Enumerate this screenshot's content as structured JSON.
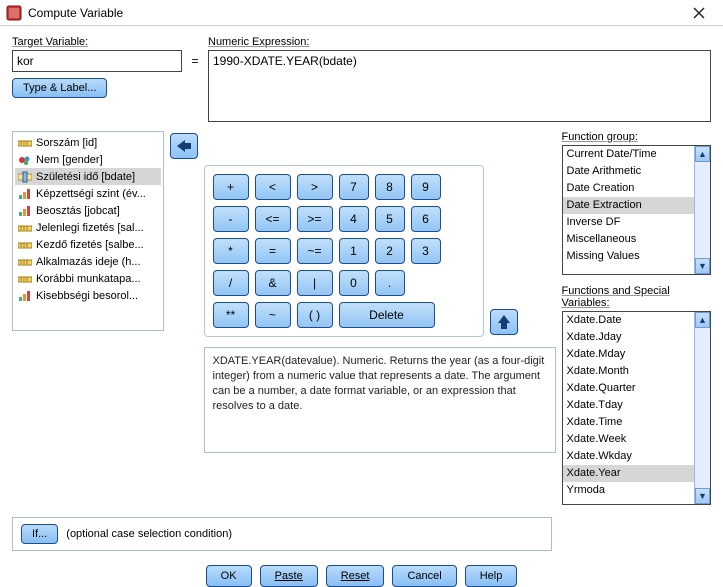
{
  "window": {
    "title": "Compute Variable"
  },
  "target": {
    "label": "Target Variable:",
    "value": "kor",
    "type_label_btn": "Type & Label..."
  },
  "equals": "=",
  "expression": {
    "label": "Numeric Expression:",
    "value": "1990-XDATE.YEAR(bdate)"
  },
  "variables": [
    {
      "label": "Sorszám [id]",
      "icon": "ruler",
      "selected": false
    },
    {
      "label": "Nem [gender]",
      "icon": "nominal",
      "selected": false
    },
    {
      "label": "Születési idő [bdate]",
      "icon": "scale",
      "selected": true
    },
    {
      "label": "Képzettségi szint (év...",
      "icon": "ordinal",
      "selected": false
    },
    {
      "label": "Beosztás [jobcat]",
      "icon": "ordinal",
      "selected": false
    },
    {
      "label": "Jelenlegi fizetés [sal...",
      "icon": "ruler",
      "selected": false
    },
    {
      "label": "Kezdő fizetés [salbe...",
      "icon": "ruler",
      "selected": false
    },
    {
      "label": "Alkalmazás ideje (h...",
      "icon": "ruler",
      "selected": false
    },
    {
      "label": "Korábbi munkatapa...",
      "icon": "ruler",
      "selected": false
    },
    {
      "label": "Kisebbségi besorol...",
      "icon": "ordinal",
      "selected": false
    }
  ],
  "keypad": {
    "rows": [
      [
        "+",
        "<",
        ">",
        "7",
        "8",
        "9"
      ],
      [
        "-",
        "<=",
        ">=",
        "4",
        "5",
        "6"
      ],
      [
        "*",
        "=",
        "~=",
        "1",
        "2",
        "3"
      ],
      [
        "/",
        "&",
        "|",
        "0",
        "."
      ],
      [
        "**",
        "~",
        "( )",
        "Delete"
      ]
    ]
  },
  "function_group": {
    "label": "Function group:",
    "items": [
      {
        "label": "Current Date/Time",
        "selected": false
      },
      {
        "label": "Date Arithmetic",
        "selected": false
      },
      {
        "label": "Date Creation",
        "selected": false
      },
      {
        "label": "Date Extraction",
        "selected": true
      },
      {
        "label": "Inverse DF",
        "selected": false
      },
      {
        "label": "Miscellaneous",
        "selected": false
      },
      {
        "label": "Missing Values",
        "selected": false
      }
    ]
  },
  "functions": {
    "label": "Functions and Special Variables:",
    "items": [
      {
        "label": "Xdate.Date",
        "selected": false
      },
      {
        "label": "Xdate.Jday",
        "selected": false
      },
      {
        "label": "Xdate.Mday",
        "selected": false
      },
      {
        "label": "Xdate.Month",
        "selected": false
      },
      {
        "label": "Xdate.Quarter",
        "selected": false
      },
      {
        "label": "Xdate.Tday",
        "selected": false
      },
      {
        "label": "Xdate.Time",
        "selected": false
      },
      {
        "label": "Xdate.Week",
        "selected": false
      },
      {
        "label": "Xdate.Wkday",
        "selected": false
      },
      {
        "label": "Xdate.Year",
        "selected": true
      },
      {
        "label": "Yrmoda",
        "selected": false
      }
    ]
  },
  "description": "XDATE.YEAR(datevalue). Numeric. Returns the year (as a four-digit integer) from a numeric value that represents a date. The argument can be a number, a date format variable, or an expression that resolves to a date.",
  "if": {
    "btn": "If...",
    "text": "(optional case selection condition)"
  },
  "buttons": {
    "ok": "OK",
    "paste": "Paste",
    "reset": "Reset",
    "cancel": "Cancel",
    "help": "Help"
  }
}
